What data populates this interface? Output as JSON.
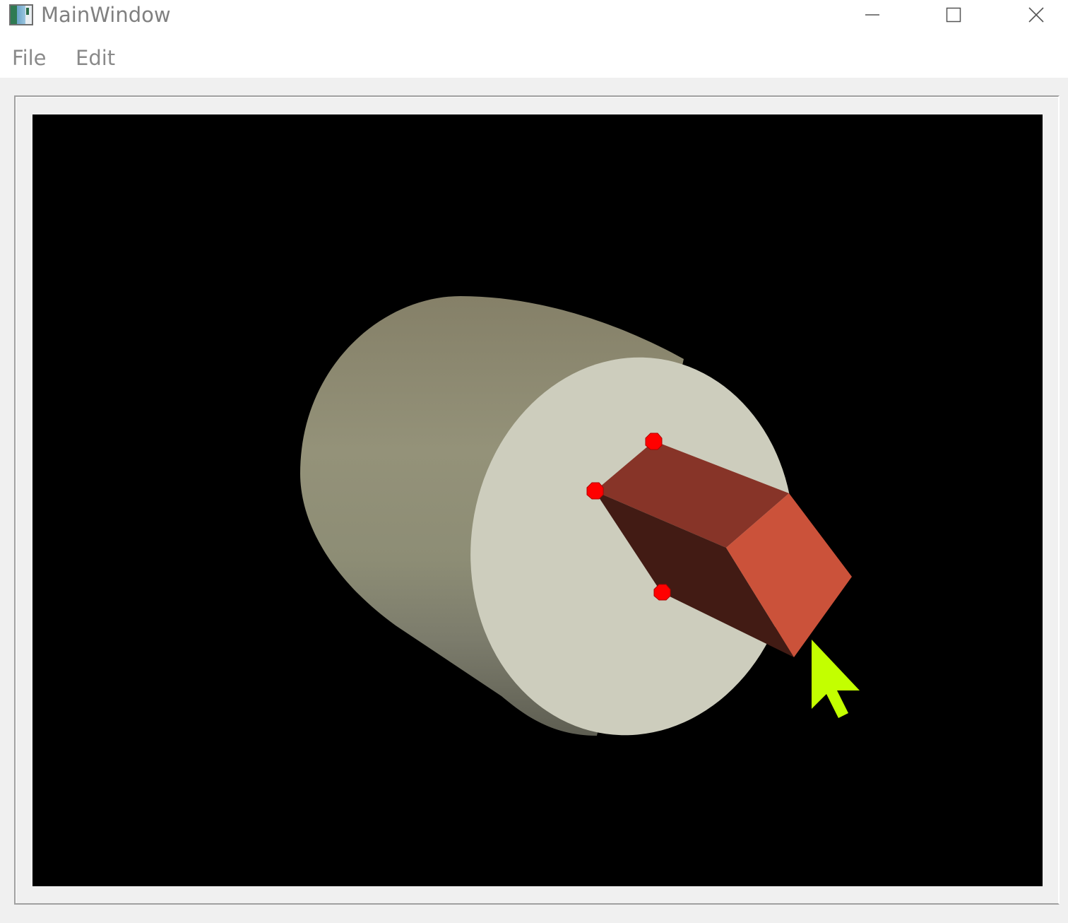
{
  "window": {
    "title": "MainWindow",
    "icon": "app-window-icon",
    "controls": {
      "minimize_icon": "minimize-icon",
      "maximize_icon": "maximize-icon",
      "close_icon": "close-icon"
    }
  },
  "menubar": {
    "items": [
      {
        "label": "File"
      },
      {
        "label": "Edit"
      }
    ]
  },
  "viewport": {
    "background": "#000000",
    "scene": {
      "cylinder_side_color": "#8c8c74",
      "cylinder_face_color": "#cdcdbd",
      "box_top_color": "#873428",
      "box_side_color": "#421b14",
      "box_front_color": "#cb523a",
      "handle_color": "#ff0000",
      "cursor_color": "#c3ff00",
      "cursor_icon": "arrow-cursor-icon"
    }
  }
}
